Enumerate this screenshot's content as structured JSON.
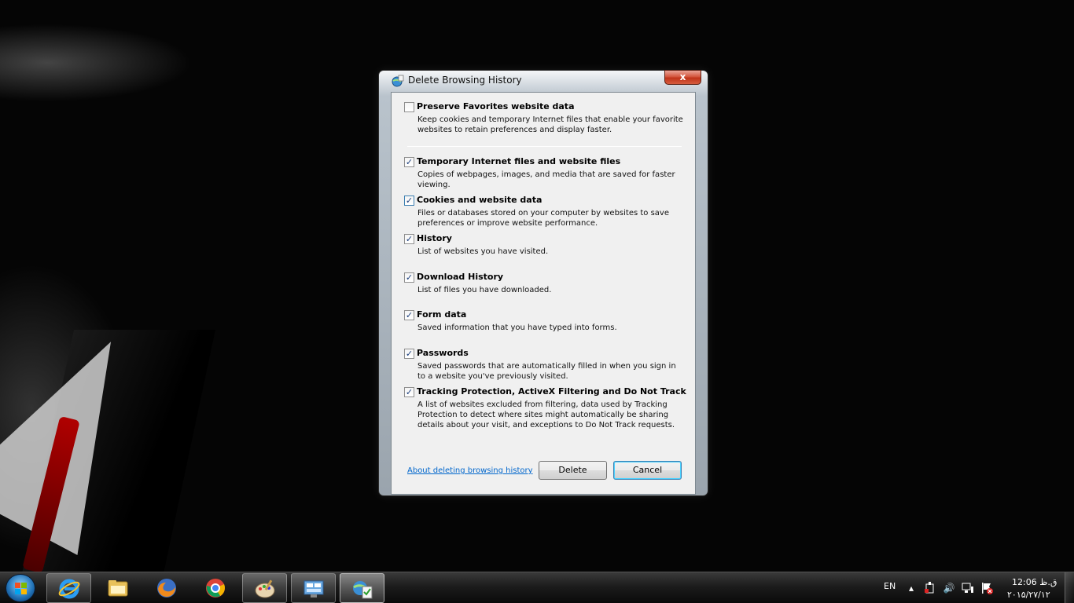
{
  "dialog": {
    "title": "Delete Browsing History",
    "close_label": "x",
    "options": [
      {
        "title": "Preserve Favorites website data",
        "description": "Keep cookies and temporary Internet files that enable your favorite websites to retain preferences and display faster.",
        "checked": false
      },
      {
        "title": "Temporary Internet files and website files",
        "description": "Copies of webpages, images, and media that are saved for faster viewing.",
        "checked": true
      },
      {
        "title": "Cookies and website data",
        "description": "Files or databases stored on your computer by websites to save preferences or improve website performance.",
        "checked": true
      },
      {
        "title": "History",
        "description": "List of websites you have visited.",
        "checked": true
      },
      {
        "title": "Download History",
        "description": "List of files you have downloaded.",
        "checked": true
      },
      {
        "title": "Form data",
        "description": "Saved information that you have typed into forms.",
        "checked": true
      },
      {
        "title": "Passwords",
        "description": "Saved passwords that are automatically filled in when you sign in to a website you've previously visited.",
        "checked": true
      },
      {
        "title": "Tracking Protection, ActiveX Filtering and Do Not Track",
        "description": "A list of websites excluded from filtering, data used by Tracking Protection to detect where sites might automatically be sharing details about your visit, and exceptions to Do Not Track requests.",
        "checked": true
      }
    ],
    "help_link": "About deleting browsing history",
    "delete_label": "Delete",
    "cancel_label": "Cancel"
  },
  "taskbar": {
    "apps": [
      {
        "name": "internet-explorer",
        "state": "pinned"
      },
      {
        "name": "file-explorer",
        "state": "pinned"
      },
      {
        "name": "firefox",
        "state": "pinned"
      },
      {
        "name": "chrome",
        "state": "pinned"
      },
      {
        "name": "paint",
        "state": "open"
      },
      {
        "name": "control-panel",
        "state": "open"
      },
      {
        "name": "internet-options",
        "state": "active"
      }
    ],
    "language": "EN",
    "time": "12:06 ق.ظ",
    "date": "۲۰۱۵/۲۷/۱۲"
  },
  "colors": {
    "link": "#0066cc",
    "close_button": "#c0341a",
    "focus_border": "#3c7fb1"
  }
}
